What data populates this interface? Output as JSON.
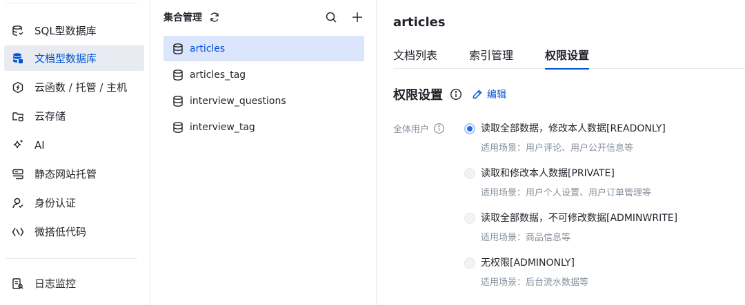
{
  "sidebar": {
    "items": [
      {
        "label": "SQL型数据库",
        "icon": "sql-db-icon"
      },
      {
        "label": "文档型数据库",
        "icon": "doc-db-icon",
        "active": true
      },
      {
        "label": "云函数 / 托管 / 主机",
        "icon": "cloud-function-icon"
      },
      {
        "label": "云存储",
        "icon": "cloud-storage-icon"
      },
      {
        "label": "AI",
        "icon": "ai-sparkle-icon"
      },
      {
        "label": "静态网站托管",
        "icon": "static-hosting-icon"
      },
      {
        "label": "身份认证",
        "icon": "identity-icon"
      },
      {
        "label": "微搭低代码",
        "icon": "lowcode-icon"
      }
    ],
    "bottom_items": [
      {
        "label": "日志监控",
        "icon": "log-monitor-icon"
      }
    ]
  },
  "collections": {
    "title": "集合管理",
    "items": [
      {
        "label": "articles",
        "active": true
      },
      {
        "label": "articles_tag"
      },
      {
        "label": "interview_questions"
      },
      {
        "label": "interview_tag"
      }
    ]
  },
  "main": {
    "title": "articles",
    "tabs": [
      {
        "label": "文档列表"
      },
      {
        "label": "索引管理"
      },
      {
        "label": "权限设置",
        "active": true
      }
    ],
    "section_title": "权限设置",
    "edit_label": "编辑",
    "permission_label": "全体用户",
    "options": [
      {
        "label": "读取全部数据，修改本人数据[READONLY]",
        "desc": "适用场景：用户评论、用户公开信息等",
        "selected": true
      },
      {
        "label": "读取和修改本人数据[PRIVATE]",
        "desc": "适用场景：用户个人设置、用户订单管理等"
      },
      {
        "label": "读取全部数据，不可修改数据[ADMINWRITE]",
        "desc": "适用场景：商品信息等"
      },
      {
        "label": "无权限[ADMINONLY]",
        "desc": "适用场景：后台流水数据等"
      }
    ]
  },
  "colors": {
    "accent": "#0052d9",
    "active_bg": "#e8ebf1",
    "selected_collection_bg": "#dbe5fb",
    "muted_text": "#86909c"
  }
}
